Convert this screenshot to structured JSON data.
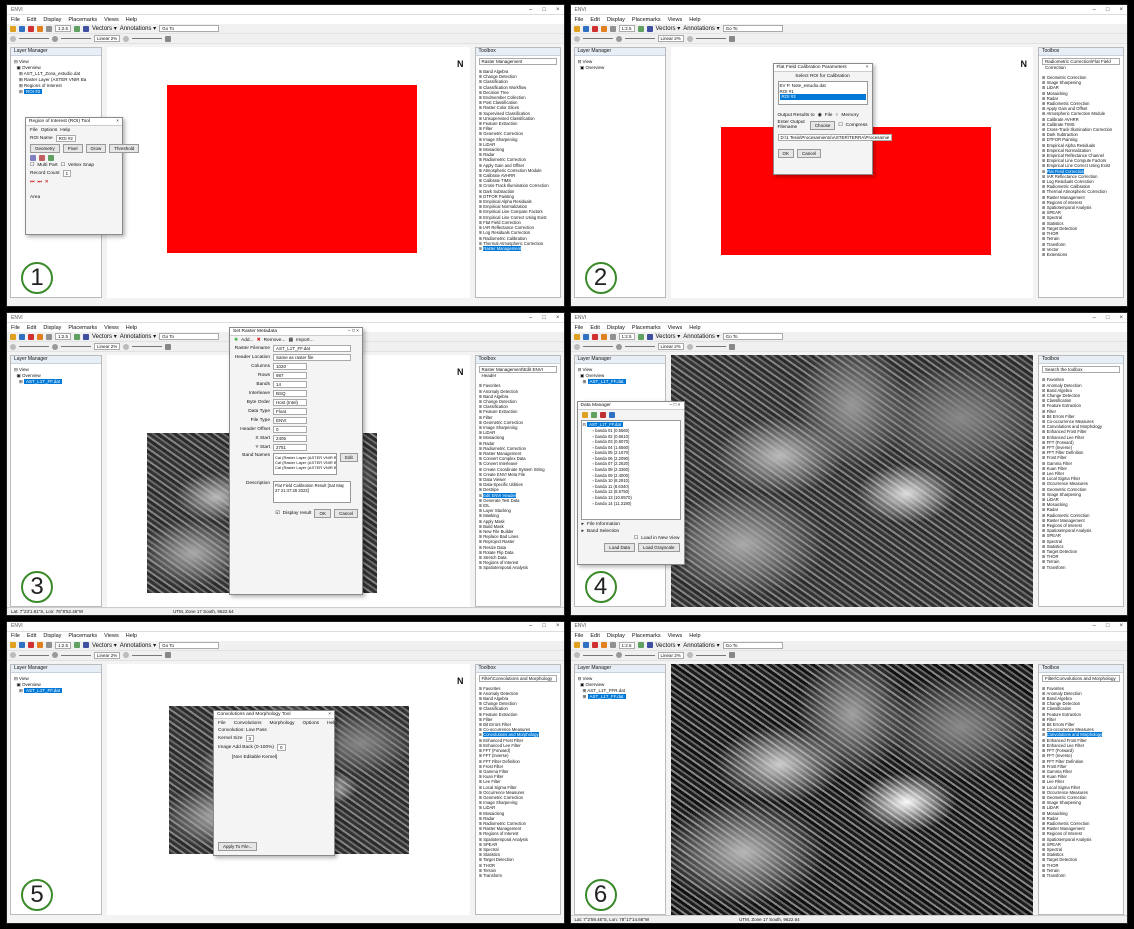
{
  "app": {
    "title": "ENVI",
    "menu": [
      "File",
      "Edit",
      "Display",
      "Placemarks",
      "Views",
      "Help"
    ],
    "vectors_label": "Vectors ▾",
    "annotations_label": "Annotations ▾",
    "goto_placeholder": "Go To",
    "stretch": "Linear 2%",
    "zoom": "1:2.5"
  },
  "common": {
    "layer_manager": "Layer Manager",
    "toolbox": "Toolbox",
    "search_placeholder": "Search the toolbox",
    "view": "View",
    "overview": "Overview"
  },
  "panel1": {
    "number": "1",
    "layers": [
      "AST_L1T_Zona_estudio.dat",
      "Raster Layer (ASTER VNIR Ba",
      "Regions of Interest",
      "ROI #2"
    ],
    "roi_tool": {
      "title": "Region of Interest (ROI) Tool",
      "menu": [
        "File",
        "Options",
        "Help"
      ],
      "roi_name_label": "ROI Name",
      "roi_name": "ROI #2",
      "tabs": [
        "Geometry",
        "Pixel",
        "Grow",
        "Threshold"
      ],
      "multi_part": "Multi Part",
      "vertex_snap": "Vertex Snap",
      "record_count_label": "Record Count",
      "record_count": "1",
      "status": "Area"
    },
    "search": "Raster Management",
    "toolbox": [
      "Band Algebra",
      "Change Detection",
      "Classification",
      "Classification Workflow",
      "Decision Tree",
      "Endmember Collection",
      "Post Classification",
      "Raster Color Slices",
      "Supervised Classification",
      "Unsupervised Classification",
      "Feature Extraction",
      "Filter",
      "Geometric Correction",
      "Image Sharpening",
      "LiDAR",
      "Mosaicking",
      "Radar",
      "Radiometric Correction",
      "Apply Gain and Offset",
      "Atmospheric Correction Module",
      "Calibrate AVHRR",
      "Calibrate TIMS",
      "Cross-Track Illumination Correction",
      "Dark Subtraction",
      "DTFOR Painting",
      "Empirical Alpha Residuals",
      "Empirical Normalization",
      "Empirical Line Compute Factors",
      "Empirical Line Correct Using Exist",
      "Flat Field Correction",
      "IAR Reflectance Correction",
      "Log Residuals Correction",
      "Radiometric Calibration",
      "Thermal Atmospheric Correction",
      "Raster Management"
    ]
  },
  "panel2": {
    "number": "2",
    "dialog": {
      "title": "Flat Field Calibration Parameters",
      "select_label": "Select ROI for Calibration",
      "rois": [
        "EV P. Note_estudio.dat",
        "ROI #1",
        "ROI #2"
      ],
      "output_label": "Output Results to",
      "opt_file": "File",
      "opt_memory": "Memory",
      "filename_label": "Enter Output Filename",
      "choose": "Choose",
      "compress": "Compress",
      "path": "D:\\1 Tesis\\Procesamiento\\ASTER\\TERRA\\Procesamie",
      "ok": "OK",
      "cancel": "Cancel"
    },
    "search": "Radiometric Correction\\Flat Field Correction",
    "toolbox": [
      "Geometric Correction",
      "Image Sharpening",
      "LiDAR",
      "Mosaicking",
      "Radar",
      "Radiometric Correction",
      "Apply Gain and Offset",
      "Atmospheric Correction Module",
      "Calibrate AVHRR",
      "Calibrate TIMS",
      "Cross-Track Illumination Correction",
      "Dark Subtraction",
      "DTFOR Painting",
      "Empirical Alpha Residuals",
      "Empirical Normalization",
      "Empirical Reflectance Channel",
      "Empirical Line Compute Factors",
      "Empirical Line Correct Using Exist",
      "Flat Field Correction",
      "IAR Reflectance Correction",
      "Log Residuals Correction",
      "Radiometric Calibration",
      "Thermal Atmospheric Correction",
      "Raster Management",
      "Regions of Interest",
      "Spatiotemporal Analysis",
      "SPEAR",
      "Spectral",
      "Statistics",
      "Target Detection",
      "THOR",
      "Terrain",
      "Transform",
      "Vector",
      "Extensions"
    ]
  },
  "panel3": {
    "number": "3",
    "layers": [
      "AST_L1T_FF.dat"
    ],
    "dialog": {
      "title": "Set Raster Metadata",
      "add": "Add...",
      "remove": "Remove...",
      "import": "Import...",
      "fields": [
        [
          "Raster Filename",
          "AST_L1T_FF.dat"
        ],
        [
          "Header Location",
          "Same as raster file"
        ],
        [
          "Columns",
          "1020"
        ],
        [
          "Rows",
          "987"
        ],
        [
          "Bands",
          "14"
        ],
        [
          "Interleave",
          "BSQ"
        ],
        [
          "Byte Order",
          "Host (Intel)"
        ],
        [
          "Data Type",
          "Float"
        ],
        [
          "File Type",
          "ENVI"
        ],
        [
          "Header Offset",
          "0"
        ],
        [
          "X Start",
          "2405"
        ],
        [
          "Y Start",
          "2751"
        ]
      ],
      "band_names_label": "Band Names",
      "band_names": [
        "Cal (Raster Layer (ASTER VNIR B",
        "Cal (Raster Layer (ASTER VNIR B",
        "Cal (Raster Layer (ASTER VNIR B"
      ],
      "edit": "Edit",
      "desc_label": "Description",
      "optional": "optional",
      "description": "Flat Field Calibration Result [Sat May 27 21:47:28 2023]",
      "display_result": "Display result",
      "ok": "OK",
      "cancel": "Cancel"
    },
    "search": "Raster Management\\Edit ENVI Header",
    "toolbox": [
      "Favorites",
      "Anomaly Detection",
      "Band Algebra",
      "Change Detection",
      "Classification",
      "Feature Extraction",
      "Filter",
      "Geometric Correction",
      "Image Sharpening",
      "LiDAR",
      "Mosaicking",
      "Radar",
      "Radiometric Correction",
      "Raster Management",
      "Convert Complex Data",
      "Convert Interleave",
      "Create Coordinate System String",
      "Create ENVI Meta File",
      "Data Viewer",
      "Data-Specific Utilities",
      "Destripe",
      "Edit ENVI Header",
      "Generate Test Data",
      "IDL",
      "Layer Stacking",
      "Masking",
      "Apply Mask",
      "Build Mask",
      "New File Builder",
      "Replace Bad Lines",
      "Reproject Raster",
      "Resize Data",
      "Rotate Flip Data",
      "Stretch Data",
      "Regions of Interest",
      "Spatiotemporal Analysis"
    ],
    "status_left": "Lat: 7°23'1.81\"S, Lon: 78°8'52.46\"W",
    "status_right": "UTM, Zone 17 South, 9622.64"
  },
  "panel4": {
    "number": "4",
    "layers": [
      "AST_L1T_FF.dat"
    ],
    "dm": {
      "title": "Data Manager",
      "file": "AST_L1T_FF.dat",
      "bands": [
        "banda 01 (0.5560)",
        "banda 02 (0.6610)",
        "banda 03 (0.8070)",
        "banda 04 (1.6560)",
        "banda 05 (2.1670)",
        "banda 06 (2.2090)",
        "banda 07 (2.2620)",
        "banda 08 (2.3360)",
        "banda 09 (2.4000)",
        "banda 10 (8.2910)",
        "banda 11 (8.6340)",
        "banda 12 (8.5750)",
        "banda 13 (10.6570)",
        "banda 14 (11.3180)"
      ],
      "file_info": "File Information",
      "band_sel": "Band Selection",
      "load_new": "Load in New View",
      "load_data": "Load Data",
      "load_rgb": "Load Grayscale"
    },
    "search": "Search the toolbox",
    "toolbox": [
      "Favorites",
      "Anomaly Detection",
      "Band Algebra",
      "Change Detection",
      "Classification",
      "Feature Extraction",
      "Filter",
      "Bit Errors Filter",
      "Co-occurrence Measures",
      "Convolutions and Morphology",
      "Enhanced Frost Filter",
      "Enhanced Lee Filter",
      "FFT (Forward)",
      "FFT (Inverse)",
      "FFT Filter Definition",
      "Frost Filter",
      "Gamma Filter",
      "Kuan Filter",
      "Lee Filter",
      "Local Sigma Filter",
      "Occurrence Measures",
      "Geometric Correction",
      "Image Sharpening",
      "LiDAR",
      "Mosaicking",
      "Radar",
      "Radiometric Correction",
      "Raster Management",
      "Regions of Interest",
      "Spatiotemporal Analysis",
      "SPEAR",
      "Spectral",
      "Statistics",
      "Target Detection",
      "THOR",
      "Terrain",
      "Transform"
    ]
  },
  "panel5": {
    "number": "5",
    "layers": [
      "AST_L1T_FF.dat"
    ],
    "conv": {
      "title": "Convolutions and Morphology Tool",
      "menu": [
        "File",
        "Convolutions",
        "Morphology",
        "Options",
        "Help"
      ],
      "type": "Convolution: Low Pass",
      "kernel_label": "Kernel Size",
      "kernel": "3",
      "add_back_label": "Image Add Back (0-100%)",
      "add_back": "0",
      "editable": "[Non Editable Kernel]",
      "apply": "Apply To File..."
    },
    "search": "Filter\\Convolutions and Morphology",
    "toolbox": [
      "Favorites",
      "Anomaly Detection",
      "Band Algebra",
      "Change Detection",
      "Classification",
      "Feature Extraction",
      "Filter",
      "Bit Errors Filter",
      "Co-occurrence Measures",
      "Convolutions and Morphology",
      "Enhanced Frost Filter",
      "Enhanced Lee Filter",
      "FFT (Forward)",
      "FFT (Inverse)",
      "FFT Filter Definition",
      "Frost Filter",
      "Gamma Filter",
      "Kuan Filter",
      "Lee Filter",
      "Local Sigma Filter",
      "Occurrence Measures",
      "Geometric Correction",
      "Image Sharpening",
      "LiDAR",
      "Mosaicking",
      "Radar",
      "Radiometric Correction",
      "Raster Management",
      "Regions of Interest",
      "Spatiotemporal Analysis",
      "SPEAR",
      "Spectral",
      "Statistics",
      "Target Detection",
      "THOR",
      "Terrain",
      "Transform"
    ]
  },
  "panel6": {
    "number": "6",
    "layers": [
      "AST_L1T_FFR.dat",
      "AST_L1T_FF.dat"
    ],
    "search": "Filter\\Convolutions and Morphology",
    "toolbox": [
      "Favorites",
      "Anomaly Detection",
      "Band Algebra",
      "Change Detection",
      "Classification",
      "Feature Extraction",
      "Filter",
      "Bit Errors Filter",
      "Co-occurrence Measures",
      "Convolutions and Morphology",
      "Enhanced Frost Filter",
      "Enhanced Lee Filter",
      "FFT (Forward)",
      "FFT (Inverse)",
      "FFT Filter Definition",
      "Frost Filter",
      "Gamma Filter",
      "Kuan Filter",
      "Lee Filter",
      "Local Sigma Filter",
      "Occurrence Measures",
      "Geometric Correction",
      "Image Sharpening",
      "LiDAR",
      "Mosaicking",
      "Radar",
      "Radiometric Correction",
      "Raster Management",
      "Regions of Interest",
      "Spatiotemporal Analysis",
      "SPEAR",
      "Spectral",
      "Statistics",
      "Target Detection",
      "THOR",
      "Terrain",
      "Transform"
    ],
    "status_left": "Lat: 7°2'59.46\"S, Lon: 78°17'14.66\"W",
    "status_right": "UTM, Zone 17 South, 9622.64"
  }
}
